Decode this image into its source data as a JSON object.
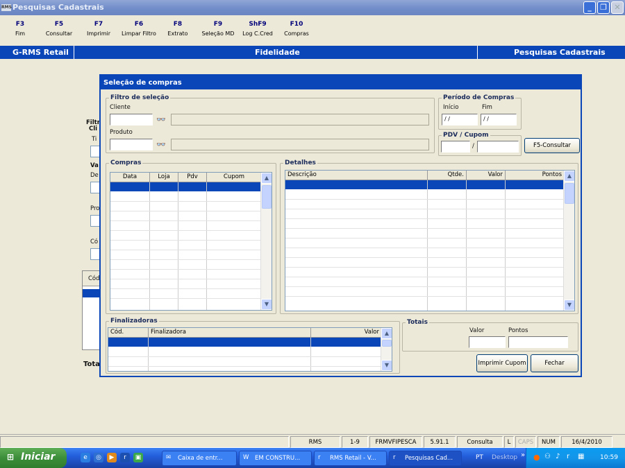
{
  "window": {
    "logo": "RMS",
    "title": "Pesquisas Cadastrais"
  },
  "fkeys": [
    {
      "key": "F3",
      "label": "Fim"
    },
    {
      "key": "F5",
      "label": "Consultar"
    },
    {
      "key": "F7",
      "label": "Imprimir"
    },
    {
      "key": "F6",
      "label": "Limpar Filtro"
    },
    {
      "key": "F8",
      "label": "Extrato"
    },
    {
      "key": "F9",
      "label": "Seleção MD"
    },
    {
      "key": "ShF9",
      "label": "Log C.Cred"
    },
    {
      "key": "F10",
      "label": "Compras"
    }
  ],
  "header": {
    "left": "G-RMS Retail",
    "center": "Fidelidade",
    "right": "Pesquisas Cadastrais"
  },
  "background_form": {
    "filtro": "Filtr",
    "cli": "Cli",
    "tipo": "Ti",
    "va": "Va",
    "de": "De",
    "pro": "Pro",
    "cod": "Có",
    "cod2": "Cód",
    "total": "Tota"
  },
  "dialog": {
    "title": "Seleção de compras",
    "filtro": {
      "title": "Filtro de seleção",
      "cliente_label": "Cliente",
      "produto_label": "Produto",
      "cliente_value": "",
      "produto_value": ""
    },
    "periodo": {
      "title": "Período de Compras",
      "inicio_label": "Início",
      "fim_label": "Fim",
      "inicio_value": "/ /",
      "fim_value": "/ /"
    },
    "pdv": {
      "title": "PDV / Cupom",
      "separator": "/",
      "pdv_value": "",
      "cupom_value": ""
    },
    "consultar_button": "F5-Consultar",
    "compras": {
      "title": "Compras",
      "columns": [
        "Data",
        "Loja",
        "Pdv",
        "Cupom"
      ]
    },
    "detalhes": {
      "title": "Detalhes",
      "columns": [
        "Descrição",
        "Qtde.",
        "Valor",
        "Pontos"
      ]
    },
    "finalizadoras": {
      "title": "Finalizadoras",
      "columns": [
        "Cód.",
        "Finalizadora",
        "Valor"
      ]
    },
    "totais": {
      "title": "Totais",
      "valor_label": "Valor",
      "pontos_label": "Pontos",
      "valor_value": "",
      "pontos_value": ""
    },
    "imprimir_button": "Imprimir Cupom",
    "fechar_button": "Fechar"
  },
  "statusbar": [
    "RMS",
    "1-9",
    "FRMVFIPESCA",
    "5.91.1",
    "Consulta",
    "L",
    "CAPS",
    "NUM",
    "16/4/2010"
  ],
  "taskbar": {
    "start": "Iniciar",
    "tasks": [
      "Caixa de entr...",
      "EM CONSTRU...",
      "RMS Retail - V...",
      "Pesquisas Cad..."
    ],
    "lang": "PT",
    "desktop": "Desktop",
    "more": "»",
    "clock": "10:59"
  }
}
